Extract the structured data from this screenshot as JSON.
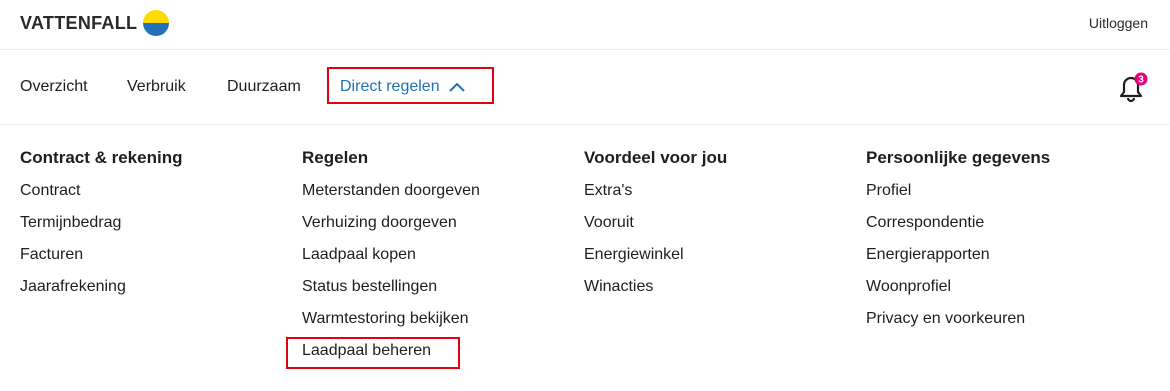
{
  "header": {
    "brand": "VATTENFALL",
    "logout_label": "Uitloggen"
  },
  "nav": {
    "items": [
      {
        "label": "Overzicht"
      },
      {
        "label": "Verbruik"
      },
      {
        "label": "Duurzaam"
      },
      {
        "label": "Direct regelen"
      }
    ],
    "notification_count": "3"
  },
  "menu": {
    "columns": [
      {
        "title": "Contract & rekening",
        "items": [
          "Contract",
          "Termijnbedrag",
          "Facturen",
          "Jaarafrekening"
        ]
      },
      {
        "title": "Regelen",
        "items": [
          "Meterstanden doorgeven",
          "Verhuizing doorgeven",
          "Laadpaal kopen",
          "Status bestellingen",
          "Warmtestoring bekijken",
          "Laadpaal beheren"
        ]
      },
      {
        "title": "Voordeel voor jou",
        "items": [
          "Extra's",
          "Vooruit",
          "Energiewinkel",
          "Winacties"
        ]
      },
      {
        "title": "Persoonlijke gegevens",
        "items": [
          "Profiel",
          "Correspondentie",
          "Energierapporten",
          "Woonprofiel",
          "Privacy en voorkeuren"
        ]
      }
    ]
  },
  "colors": {
    "accent": "#2071b5",
    "brand_yellow": "#ffda00",
    "highlight_red": "#e3000f",
    "badge": "#e6007e"
  }
}
